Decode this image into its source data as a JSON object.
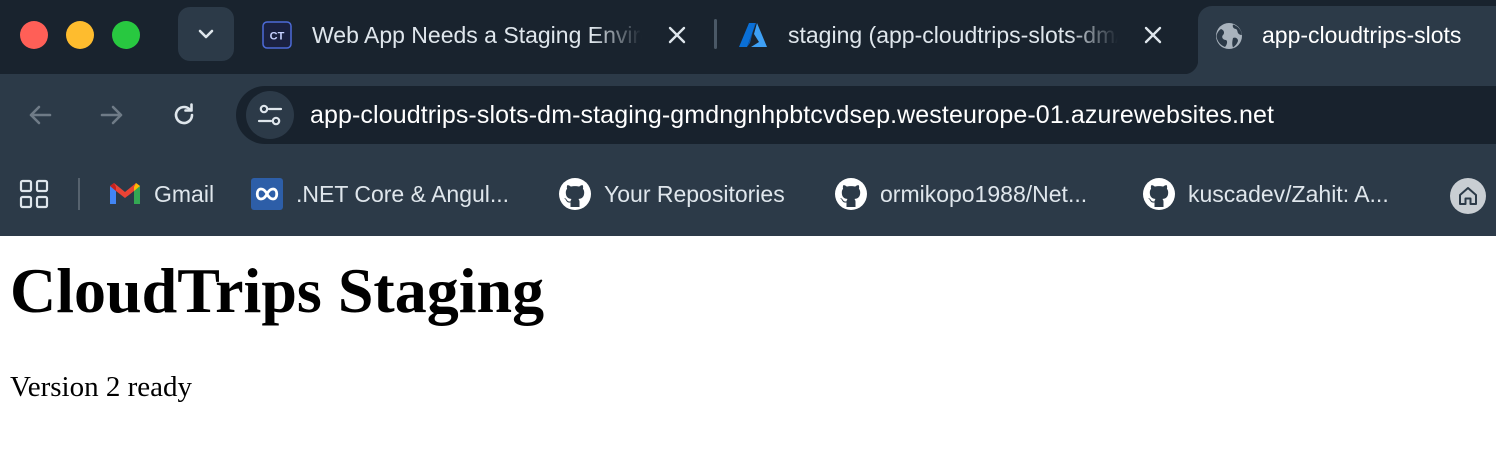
{
  "browser": {
    "tabs": [
      {
        "title": "Web App Needs a Staging Environment",
        "favicon": "cloudtrips-ct-icon",
        "favicon_text": "CT",
        "active": false
      },
      {
        "title": "staging (app-cloudtrips-slots-dm/staging)",
        "favicon": "azure-icon",
        "active": false
      },
      {
        "title": "app-cloudtrips-slots",
        "favicon": "globe-icon",
        "active": true
      }
    ],
    "url": "app-cloudtrips-slots-dm-staging-gmdngnhpbtcvdsep.westeurope-01.azurewebsites.net",
    "bookmarks": [
      {
        "label": "Gmail",
        "icon": "gmail-icon"
      },
      {
        "label": ".NET Core & Angul...",
        "icon": "infinity-icon"
      },
      {
        "label": "Your Repositories",
        "icon": "github-icon"
      },
      {
        "label": "ormikopo1988/Net...",
        "icon": "github-icon"
      },
      {
        "label": "kuscadev/Zahit: A...",
        "icon": "github-icon"
      }
    ],
    "colors": {
      "tabstrip_bg": "#19232e",
      "toolbar_bg": "#2c3a48",
      "omnibox_bg": "#18222d",
      "close_red": "#ff5f57",
      "minimize_yellow": "#febc2e",
      "zoom_green": "#28c840"
    }
  },
  "page": {
    "heading": "CloudTrips Staging",
    "text": "Version 2 ready"
  }
}
